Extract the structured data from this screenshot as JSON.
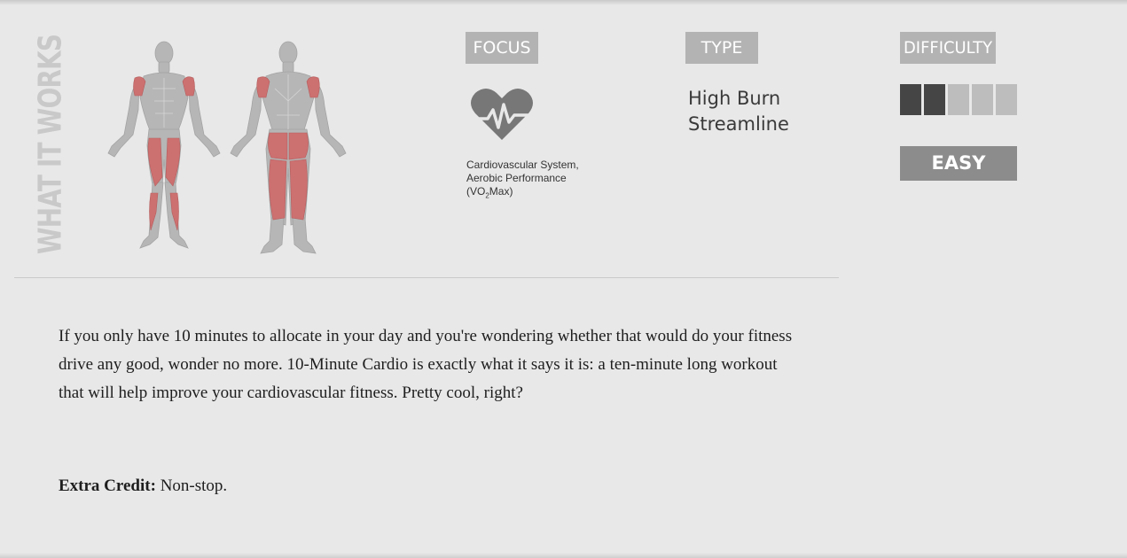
{
  "section": {
    "title": "WHAT IT WORKS"
  },
  "muscle_map": {
    "views": [
      "front",
      "back"
    ],
    "highlighted_muscles": [
      "shoulders",
      "glutes",
      "quadriceps",
      "hamstrings",
      "adductors"
    ],
    "highlight_color": "#cd7070",
    "body_color": "#b6b6b6"
  },
  "focus": {
    "label": "FOCUS",
    "icon": "heart-pulse-icon",
    "line1": "Cardiovascular System,",
    "line2": "Aerobic Performance",
    "line3_prefix": "(VO",
    "line3_sub": "2",
    "line3_suffix": "Max)"
  },
  "type": {
    "label": "TYPE",
    "values": [
      "High Burn",
      "Streamline"
    ]
  },
  "difficulty": {
    "label": "DIFFICULTY",
    "level": 2,
    "max": 5,
    "filled_color": "#454545",
    "empty_color": "#bdbdbd",
    "rating": "EASY"
  },
  "description": "If you only have 10 minutes to allocate in your day and you're wondering whether that would do your fitness drive any good, wonder no more. 10-Minute Cardio is exactly what it says it is: a ten-minute long workout that will help improve your cardiovascular fitness. Pretty cool, right?",
  "extra_credit": {
    "label": "Extra Credit:",
    "value": "Non-stop."
  }
}
